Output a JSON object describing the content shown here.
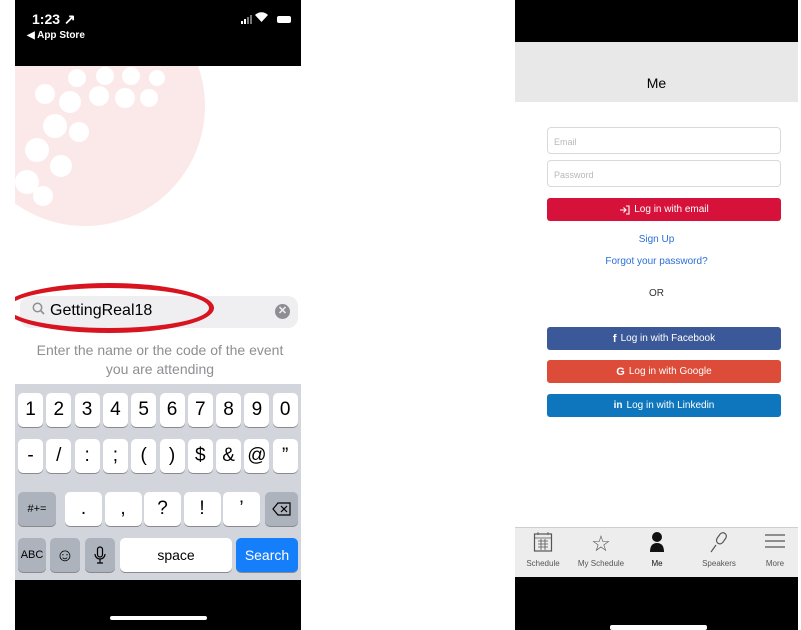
{
  "left": {
    "status": {
      "time": "1:23 ↗",
      "back_label": "◀ App Store"
    },
    "search": {
      "value": "GettingReal18"
    },
    "hint": "Enter the name or the code of the event you are attending",
    "keyboard": {
      "row1": [
        "1",
        "2",
        "3",
        "4",
        "5",
        "6",
        "7",
        "8",
        "9",
        "0"
      ],
      "row2": [
        "-",
        "/",
        ":",
        ";",
        "(",
        ")",
        "$",
        "&",
        "@",
        "”"
      ],
      "row3": [
        ".",
        ",",
        "?",
        "!",
        "’"
      ],
      "shift_label": "#+=",
      "abc_label": "ABC",
      "space_label": "space",
      "search_label": "Search"
    }
  },
  "right": {
    "title": "Me",
    "email_placeholder": "Email",
    "password_placeholder": "Password",
    "login_email_label": "Log in with email",
    "signup_label": "Sign Up",
    "forgot_label": "Forgot your password?",
    "or_label": "OR",
    "facebook_label": "Log in with Facebook",
    "google_label": "Log in with Google",
    "linkedin_label": "Log in with Linkedin",
    "tabs": [
      {
        "label": "Schedule",
        "icon": "calendar-icon"
      },
      {
        "label": "My Schedule",
        "icon": "star-icon"
      },
      {
        "label": "Me",
        "icon": "person-icon"
      },
      {
        "label": "Speakers",
        "icon": "microphone-icon"
      },
      {
        "label": "More",
        "icon": "menu-icon"
      }
    ],
    "colors": {
      "email_button": "#d6123b",
      "facebook": "#3b5998",
      "google": "#dd4b39",
      "linkedin": "#0e76bd",
      "link": "#2a6fd6"
    }
  }
}
